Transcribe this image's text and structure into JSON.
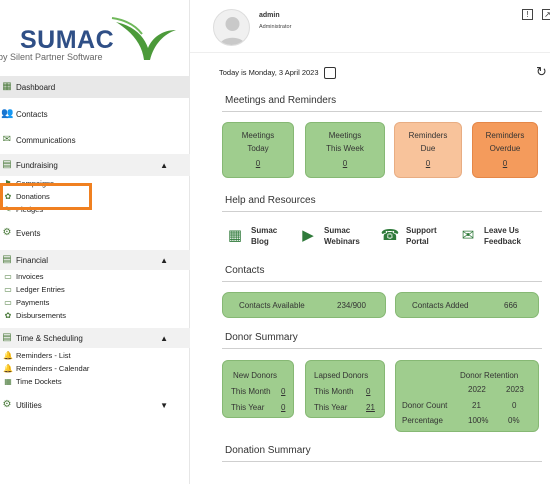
{
  "brand": {
    "name": "SUMAC",
    "tagline": "by Silent Partner Software"
  },
  "sidebar": {
    "items": [
      {
        "label": "Dashboard",
        "icon": "dashboard-icon"
      },
      {
        "label": "Contacts",
        "icon": "contacts-icon"
      },
      {
        "label": "Communications",
        "icon": "communications-icon"
      },
      {
        "label": "Fundraising",
        "icon": "fundraising-icon"
      },
      {
        "label": "Campaigns",
        "icon": "campaigns-icon"
      },
      {
        "label": "Donations",
        "icon": "donations-icon"
      },
      {
        "label": "Pledges",
        "icon": "pledges-icon"
      },
      {
        "label": "Events",
        "icon": "events-icon"
      },
      {
        "label": "Financial",
        "icon": "financial-icon"
      },
      {
        "label": "Invoices",
        "icon": "invoices-icon"
      },
      {
        "label": "Ledger Entries",
        "icon": "ledger-icon"
      },
      {
        "label": "Payments",
        "icon": "payments-icon"
      },
      {
        "label": "Disbursements",
        "icon": "disbursements-icon"
      },
      {
        "label": "Time & Scheduling",
        "icon": "time-icon"
      },
      {
        "label": "Reminders - List",
        "icon": "reminders-list-icon"
      },
      {
        "label": "Reminders - Calendar",
        "icon": "reminders-calendar-icon"
      },
      {
        "label": "Time Dockets",
        "icon": "time-dockets-icon"
      },
      {
        "label": "Utilities",
        "icon": "utilities-icon"
      }
    ]
  },
  "header": {
    "user": "admin",
    "role": "Administrator"
  },
  "date_line": "Today is Monday, 3 April 2023",
  "meetings": {
    "title": "Meetings and Reminders",
    "cards": [
      {
        "line1": "Meetings",
        "line2": "Today",
        "value": "0",
        "color": "#9fcd8e"
      },
      {
        "line1": "Meetings",
        "line2": "This Week",
        "value": "0",
        "color": "#9fcd8e"
      },
      {
        "line1": "Reminders",
        "line2": "Due",
        "value": "0",
        "color": "#f8c39b"
      },
      {
        "line1": "Reminders",
        "line2": "Overdue",
        "value": "0",
        "color": "#f49b5c"
      }
    ]
  },
  "resources": {
    "title": "Help and Resources",
    "items": [
      {
        "line1": "Sumac",
        "line2": "Blog"
      },
      {
        "line1": "Sumac",
        "line2": "Webinars"
      },
      {
        "line1": "Support",
        "line2": "Portal"
      },
      {
        "line1": "Leave Us",
        "line2": "Feedback"
      }
    ]
  },
  "contacts": {
    "title": "Contacts",
    "available_label": "Contacts Available",
    "available_value": "234/900",
    "added_label": "Contacts Added",
    "added_value": "666"
  },
  "donor_summary": {
    "title": "Donor Summary",
    "new_donors": {
      "title": "New Donors",
      "month_label": "This Month",
      "month_value": "0",
      "year_label": "This Year",
      "year_value": "0"
    },
    "lapsed_donors": {
      "title": "Lapsed Donors",
      "month_label": "This Month",
      "month_value": "0",
      "year_label": "This Year",
      "year_value": "21"
    },
    "retention": {
      "title": "Donor Retention",
      "years": [
        "2022",
        "2023"
      ],
      "count_label": "Donor Count",
      "count_values": [
        "21",
        "0"
      ],
      "pct_label": "Percentage",
      "pct_values": [
        "100%",
        "0%"
      ]
    }
  },
  "donation_summary": {
    "title": "Donation Summary"
  }
}
